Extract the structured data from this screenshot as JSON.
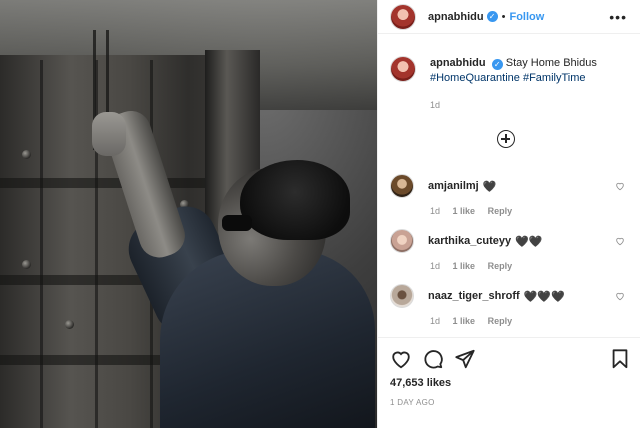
{
  "post": {
    "author": "apnabhidu",
    "follow_label": "Follow",
    "separator": "•",
    "more_label": "•••",
    "caption": {
      "author": "apnabhidu",
      "text": "Stay Home Bhidus",
      "hashtags": [
        "#HomeQuarantine",
        "#FamilyTime"
      ],
      "time": "1d"
    },
    "comments": [
      {
        "user": "amjanilmj",
        "text": "🖤",
        "time": "1d",
        "likes": "1 like",
        "reply": "Reply"
      },
      {
        "user": "karthika_cuteyy",
        "text": "🖤🖤",
        "time": "1d",
        "likes": "1 like",
        "reply": "Reply"
      },
      {
        "user": "naaz_tiger_shroff",
        "text": "🖤🖤🖤",
        "time": "1d",
        "likes": "1 like",
        "reply": "Reply"
      }
    ],
    "likes_count": "47,653 likes",
    "posted_time": "1 DAY AGO"
  },
  "icons": {
    "verified": "verified-badge-icon",
    "load_more": "plus-circle-icon",
    "comment_like": "heart-outline-icon",
    "like": "heart-outline-icon",
    "comment": "comment-bubble-icon",
    "share": "paper-plane-icon",
    "save": "bookmark-icon"
  },
  "colors": {
    "link_blue": "#3897f0",
    "hashtag": "#003569",
    "meta_gray": "#8e8e8e",
    "text": "#262626"
  }
}
